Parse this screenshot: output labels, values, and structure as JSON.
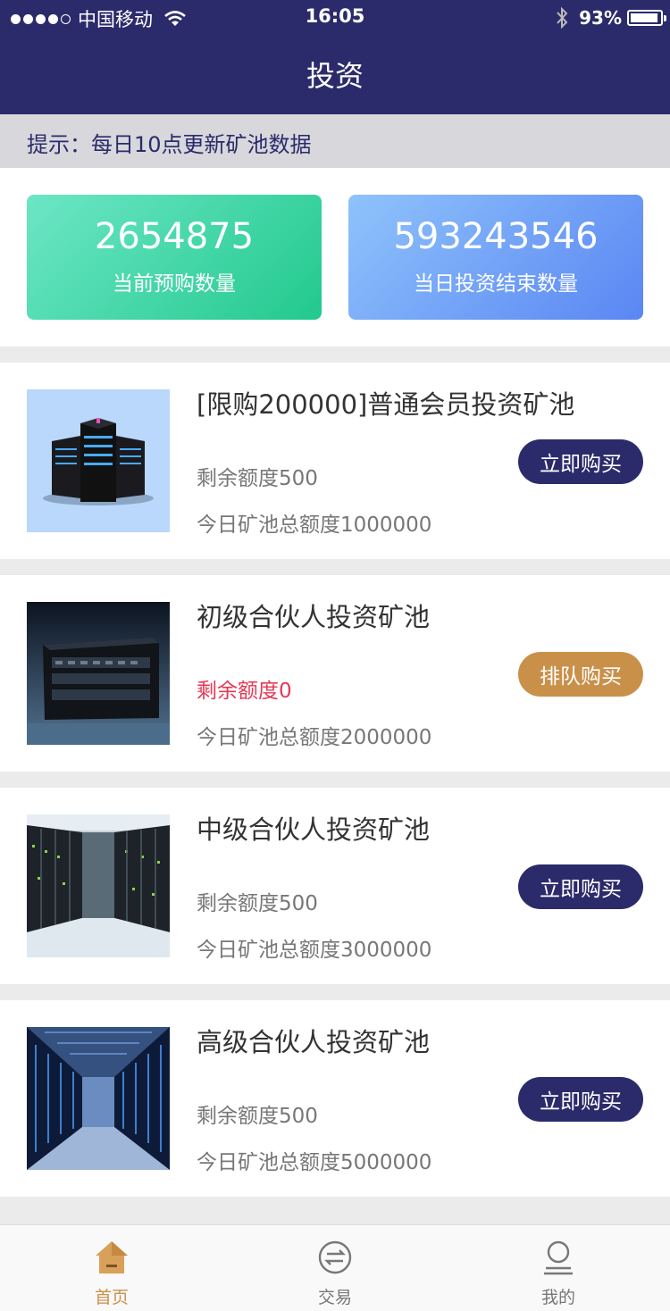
{
  "status_bar": {
    "carrier": "中国移动",
    "time": "16:05",
    "battery": "93%"
  },
  "header": {
    "title": "投资"
  },
  "notice": {
    "text": "提示：每日10点更新矿池数据"
  },
  "stats": [
    {
      "value": "2654875",
      "label": "当前预购数量"
    },
    {
      "value": "593243546",
      "label": "当日投资结束数量"
    }
  ],
  "pools": [
    {
      "name": "[限购200000]普通会员投资矿池",
      "remaining": "剩余额度500",
      "total": "今日矿池总额度1000000",
      "button": "立即购买"
    },
    {
      "name": "初级合伙人投资矿池",
      "remaining": "剩余额度0",
      "total": "今日矿池总额度2000000",
      "button": "排队购买"
    },
    {
      "name": "中级合伙人投资矿池",
      "remaining": "剩余额度500",
      "total": "今日矿池总额度3000000",
      "button": "立即购买"
    },
    {
      "name": "高级合伙人投资矿池",
      "remaining": "剩余额度500",
      "total": "今日矿池总额度5000000",
      "button": "立即购买"
    }
  ],
  "tabs": [
    {
      "label": "首页",
      "icon": "home-icon"
    },
    {
      "label": "交易",
      "icon": "exchange-icon"
    },
    {
      "label": "我的",
      "icon": "user-icon"
    }
  ],
  "colors": {
    "brand": "#2b2b6b",
    "accent": "#c9904a",
    "alert": "#e53855"
  }
}
